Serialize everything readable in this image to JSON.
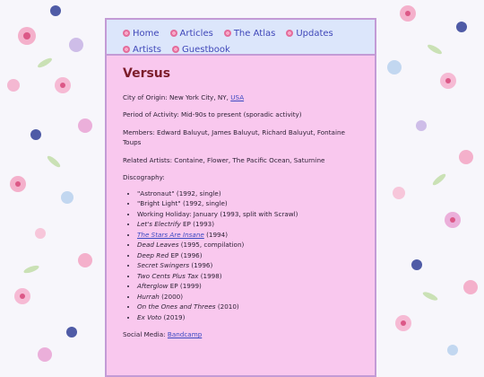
{
  "nav": {
    "items": [
      {
        "label": "Home"
      },
      {
        "label": "Articles"
      },
      {
        "label": "The Atlas"
      },
      {
        "label": "Updates"
      },
      {
        "label": "Artists"
      },
      {
        "label": "Guestbook"
      }
    ]
  },
  "page": {
    "title": "Versus",
    "origin_label": "City of Origin:",
    "origin_value": "New York City, NY,",
    "origin_link": "USA",
    "period_label": "Period of Activity:",
    "period_value": "Mid-90s to present (sporadic activity)",
    "members_label": "Members:",
    "members_value": "Edward Baluyut, James Baluyut, Richard Baluyut, Fontaine Toups",
    "related_label": "Related Artists:",
    "related_value": "Containe, Flower, The Pacific Ocean, Saturnine",
    "discography_label": "Discography:",
    "social_label": "Social Media:",
    "social_link": "Bandcamp"
  },
  "discography": [
    {
      "title": "\"Astronaut\"",
      "detail": "(1992, single)",
      "italic": false
    },
    {
      "title": "\"Bright Light\"",
      "detail": "(1992, single)",
      "italic": false
    },
    {
      "title": "Working Holiday: January",
      "detail": "(1993, split with Scrawl)",
      "italic": false
    },
    {
      "title": "Let's Electrify",
      "detail": "EP (1993)",
      "italic": true
    },
    {
      "title": "The Stars Are Insane",
      "detail": "(1994)",
      "italic": true,
      "link": true
    },
    {
      "title": "Dead Leaves",
      "detail": "(1995, compilation)",
      "italic": true
    },
    {
      "title": "Deep Red",
      "detail": "EP (1996)",
      "italic": true
    },
    {
      "title": "Secret Swingers",
      "detail": "(1996)",
      "italic": true
    },
    {
      "title": "Two Cents Plus Tax",
      "detail": "(1998)",
      "italic": true
    },
    {
      "title": "Afterglow",
      "detail": "EP (1999)",
      "italic": true
    },
    {
      "title": "Hurrah",
      "detail": "(2000)",
      "italic": true
    },
    {
      "title": "On the Ones and Threes",
      "detail": "(2010)",
      "italic": true
    },
    {
      "title": "Ex Voto",
      "detail": "(2019)",
      "italic": true
    }
  ],
  "colors": {
    "card_bg": "#f9c8ee",
    "nav_bg": "#dce6fb",
    "title": "#7c1d2b",
    "link": "#3b49c2",
    "border": "#c39bd6"
  }
}
